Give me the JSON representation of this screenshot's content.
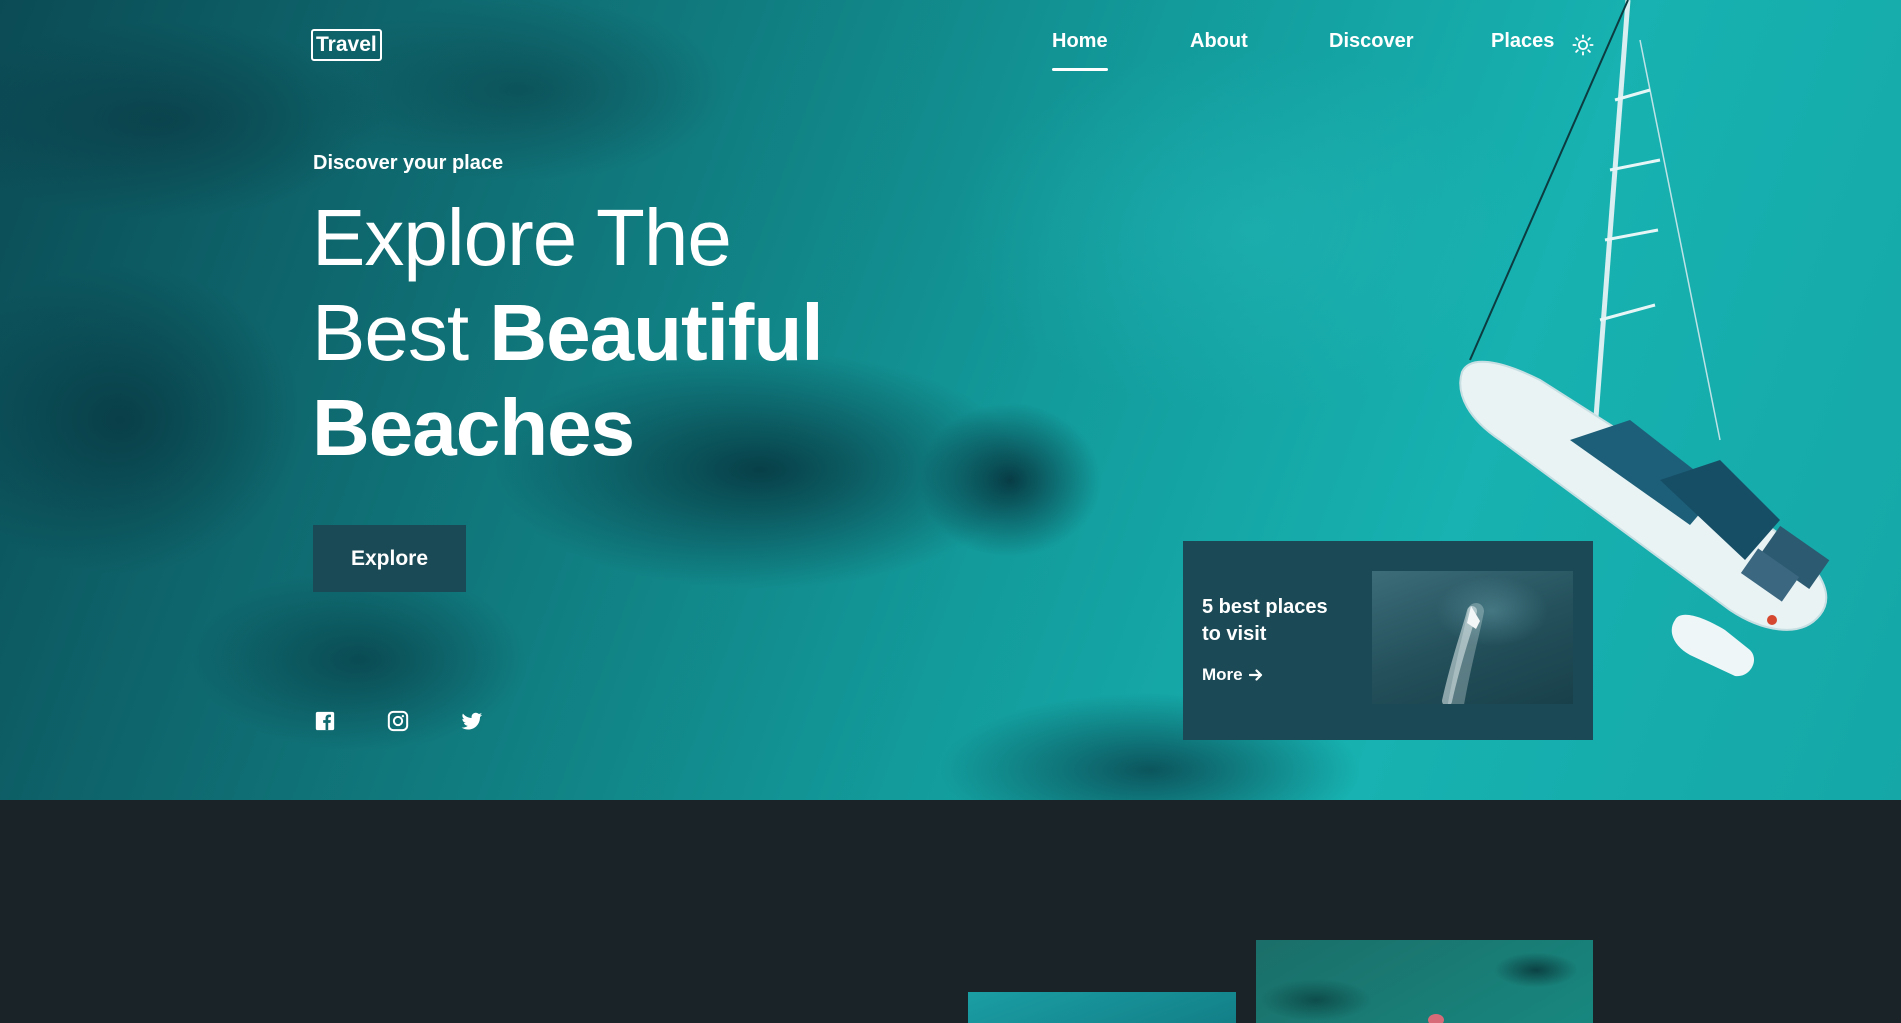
{
  "header": {
    "logo": "Travel",
    "nav": [
      {
        "label": "Home",
        "active": true
      },
      {
        "label": "About",
        "active": false
      },
      {
        "label": "Discover",
        "active": false
      },
      {
        "label": "Places",
        "active": false
      }
    ],
    "theme_icon": "sun-icon"
  },
  "hero": {
    "subtitle": "Discover your place",
    "headline": {
      "line1": "Explore The",
      "line2_regular": "Best",
      "line2_bold": "Beautiful",
      "line3": "Beaches"
    },
    "button_label": "Explore",
    "social_icons": [
      "facebook-icon",
      "instagram-icon",
      "twitter-icon"
    ]
  },
  "card": {
    "title": "5 best places to visit",
    "link_label": "More",
    "link_icon": "arrow-right-icon"
  },
  "colors": {
    "accent": "#1b4a56",
    "button": "#1a4a55",
    "dark_bg": "#1a2327",
    "sea": "#17b2b1"
  }
}
